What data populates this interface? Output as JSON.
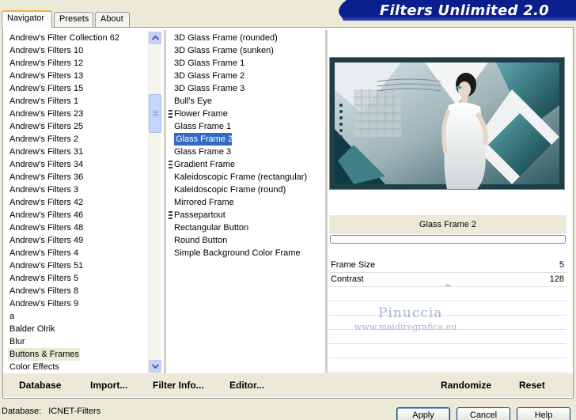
{
  "tabs": [
    {
      "label": "Navigator",
      "active": true
    },
    {
      "label": "Presets",
      "active": false
    },
    {
      "label": "About",
      "active": false
    }
  ],
  "banner": {
    "title": "Filters Unlimited 2.0"
  },
  "categories": {
    "items": [
      "Andrew's Filter Collection 62",
      "Andrew's Filters 10",
      "Andrew's Filters 12",
      "Andrew's Filters 13",
      "Andrew's Filters 15",
      "Andrew's Filters 1",
      "Andrew's Filters 23",
      "Andrew's Filters 25",
      "Andrew's Filters 2",
      "Andrew's Filters 31",
      "Andrew's Filters 34",
      "Andrew's Filters 36",
      "Andrew's Filters 3",
      "Andrew's Filters 42",
      "Andrew's Filters 46",
      "Andrew's Filters 48",
      "Andrew's Filters 49",
      "Andrew's Filters 4",
      "Andrew's Filters 51",
      "Andrew's Filters 5",
      "Andrew's Filters 8",
      "Andrew's Filters 9",
      "a",
      "Balder Olrik",
      "Blur",
      "Buttons & Frames",
      "Color Effects"
    ],
    "highlighted": "Buttons & Frames"
  },
  "filters": {
    "items": [
      {
        "label": "3D Glass Frame (rounded)",
        "marker": false
      },
      {
        "label": "3D Glass Frame (sunken)",
        "marker": false
      },
      {
        "label": "3D Glass Frame 1",
        "marker": false
      },
      {
        "label": "3D Glass Frame 2",
        "marker": false
      },
      {
        "label": "3D Glass Frame 3",
        "marker": false
      },
      {
        "label": "Bull's Eye",
        "marker": false
      },
      {
        "label": "Flower Frame",
        "marker": true
      },
      {
        "label": "Glass Frame 1",
        "marker": false
      },
      {
        "label": "Glass Frame 2",
        "marker": false
      },
      {
        "label": "Glass Frame 3",
        "marker": false
      },
      {
        "label": "Gradient Frame",
        "marker": true
      },
      {
        "label": "Kaleidoscopic Frame (rectangular)",
        "marker": false
      },
      {
        "label": "Kaleidoscopic Frame (round)",
        "marker": false
      },
      {
        "label": "Mirrored Frame",
        "marker": false
      },
      {
        "label": "Passepartout",
        "marker": true
      },
      {
        "label": "Rectangular Button",
        "marker": false
      },
      {
        "label": "Round Button",
        "marker": false
      },
      {
        "label": "Simple Background Color Frame",
        "marker": false
      }
    ],
    "selected": "Glass Frame 2"
  },
  "preview": {
    "filter_name": "Glass Frame 2"
  },
  "params": [
    {
      "label": "Frame Size",
      "value": "5"
    },
    {
      "label": "Contrast",
      "value": "128"
    }
  ],
  "watermark": {
    "name": "Pinuccia",
    "url": "www.maidiregrafica.eu"
  },
  "toolbar": {
    "database_label": "Database",
    "import_label": "Import...",
    "filter_info_label": "Filter Info...",
    "editor_label": "Editor...",
    "randomize_label": "Randomize",
    "reset_label": "Reset"
  },
  "footer": {
    "database_caption": "Database:",
    "database_value": "ICNET-Filters",
    "apply_label": "Apply",
    "cancel_label": "Cancel",
    "help_label": "Help"
  },
  "colors": {
    "selection": "#316ac5",
    "banner": "#0a1e8c",
    "scrollbar": "#c3d3fd"
  }
}
